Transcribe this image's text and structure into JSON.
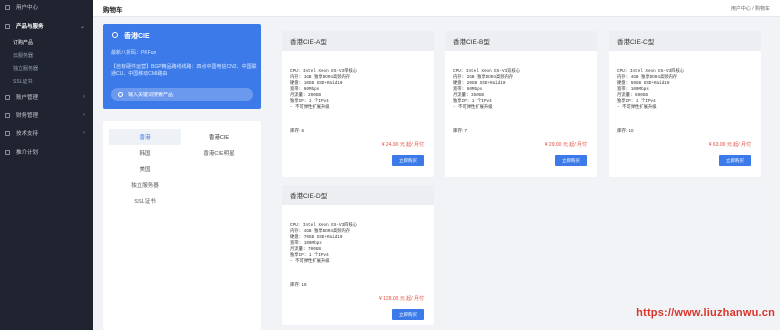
{
  "sidebar": {
    "user_center": "用户中心",
    "products": "产品与服务",
    "sub_items": [
      "订购产品",
      "云服务器",
      "独立服务器",
      "SSL证书"
    ],
    "account": "账户管理",
    "finance": "财务管理",
    "support": "技术支持",
    "affiliate": "推介计划"
  },
  "topbar": {
    "title": "购物车",
    "breadcrumb": "用户中心 / 购物车"
  },
  "info_card": {
    "title": "香港CIE",
    "line1": "最新八折码：PKFun",
    "line2": "【自有硬件运营】BGP精品路线线路：四点中国电信CN2、中国联通CU、中国移动CMI路由",
    "search_placeholder": "输入关键词搜索产品"
  },
  "categories": {
    "left": [
      "香港",
      "韩国",
      "美国",
      "独立服务器",
      "SSL证书"
    ],
    "right": [
      "香港CIE",
      "香港CIE明星"
    ]
  },
  "products": [
    {
      "name": "香港CIE-A型",
      "specs": [
        "CPU: Intel Xeon E5-V3单核心",
        "内存: 1GB 独享DDR4高频内存",
        "硬盘: 10GB SSD+Raid10",
        "宽带: 60Mbps",
        "月流量: 200GB",
        "独享IP: 1 个IPv4",
        "- 不可弹性扩展升级"
      ],
      "stock": "库存: 6",
      "price": "¥ 24.90 元 起/ 月付",
      "button": "立即购买"
    },
    {
      "name": "香港CIE-B型",
      "specs": [
        "CPU: Intel Xeon E5-V3双核心",
        "内存: 2GB 独享DDR4高频内存",
        "硬盘: 20GB SSD+Raid10",
        "宽带: 60Mbps",
        "月流量: 350GB",
        "独享IP: 1 个IPv4",
        "- 不可弹性扩展升级"
      ],
      "stock": "库存: 7",
      "price": "¥ 29.00 元 起/ 月付",
      "button": "立即购买"
    },
    {
      "name": "香港CIE-C型",
      "specs": [
        "CPU: Intel Xeon E5-V3四核心",
        "内存: 4GB 独享DDR4高频内存",
        "硬盘: 50GB SSD+Raid10",
        "宽带: 100Mbps",
        "月流量: 600GB",
        "独享IP: 1 个IPv4",
        "- 不可弹性扩展升级"
      ],
      "stock": "库存: 10",
      "price": "¥ 63.00 元 起/ 月付",
      "button": "立即购买"
    },
    {
      "name": "香港CIE-D型",
      "specs": [
        "CPU: Intel Xeon E5-V3四核心",
        "内存: 4GB 独享DDR4高频内存",
        "硬盘: 70GB SSD+Raid10",
        "宽带: 100Mbps",
        "月流量: 700GB",
        "独享IP: 1 个IPv4",
        "- 不可弹性扩展升级"
      ],
      "stock": "库存: 18",
      "price": "¥ 128.00 元 起/ 月付",
      "button": "立即购买"
    }
  ],
  "watermark": "https://www.liuzhanwu.cn",
  "colors": {
    "sidebar_bg": "#1f2430",
    "accent": "#3b7ae8",
    "price": "#e24b3b"
  }
}
